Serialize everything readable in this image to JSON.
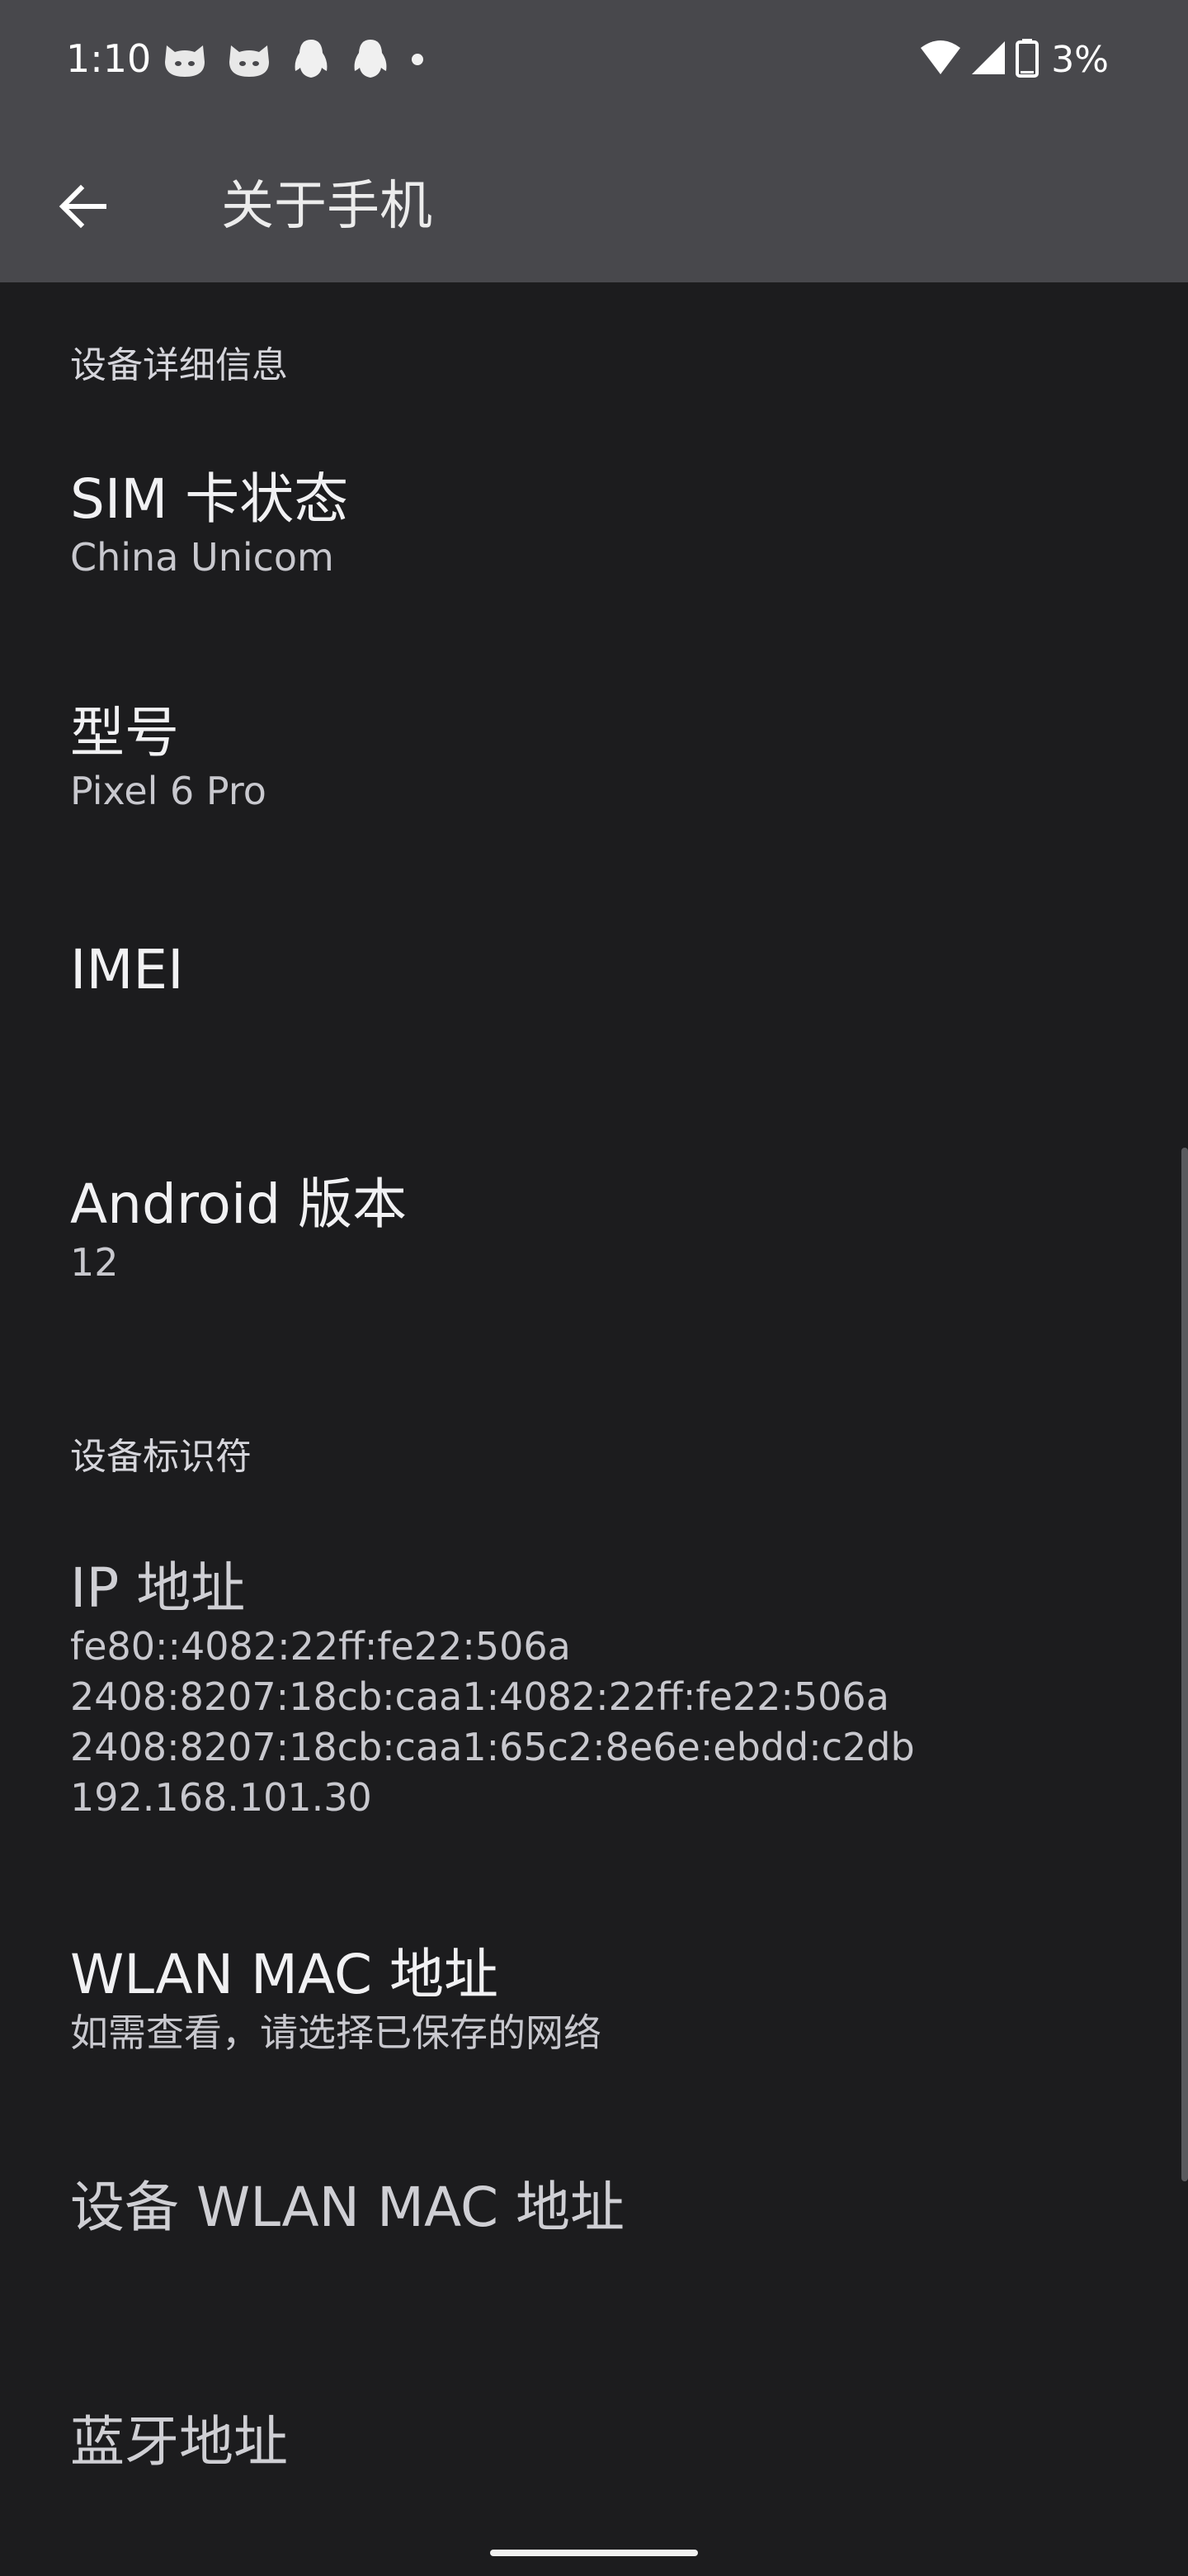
{
  "status_bar": {
    "time": "1:10",
    "battery_text": "3%",
    "notification_icons": [
      "cat-app-icon",
      "cat-app-icon",
      "qq-penguin-icon",
      "qq-penguin-icon",
      "dot-icon"
    ],
    "system_icons": [
      "wifi-icon",
      "signal-icon",
      "battery-icon"
    ]
  },
  "app_bar": {
    "title": "关于手机",
    "back_icon": "arrow-back-icon"
  },
  "sections": {
    "device_details": {
      "header": "设备详细信息",
      "items": [
        {
          "title": "SIM 卡状态",
          "summary": "China Unicom"
        },
        {
          "title": "型号",
          "summary": "Pixel 6 Pro"
        },
        {
          "title": "IMEI",
          "summary": ""
        },
        {
          "title": "Android 版本",
          "summary": "12"
        }
      ]
    },
    "device_identifiers": {
      "header": "设备标识符",
      "ip": {
        "title": "IP 地址",
        "lines": [
          "fe80::4082:22ff:fe22:506a",
          "2408:8207:18cb:caa1:4082:22ff:fe22:506a",
          "2408:8207:18cb:caa1:65c2:8e6e:ebdd:c2db",
          "192.168.101.30"
        ]
      },
      "wlan_mac": {
        "title": "WLAN MAC 地址",
        "summary": "如需查看，请选择已保存的网络"
      },
      "device_wlan_mac": {
        "title": "设备 WLAN MAC 地址"
      },
      "bluetooth": {
        "title": "蓝牙地址"
      }
    }
  },
  "colors": {
    "background": "#1c1c1e",
    "header": "#48484c",
    "text_primary": "#f1f1f3",
    "text_secondary": "#c8c8ce"
  }
}
